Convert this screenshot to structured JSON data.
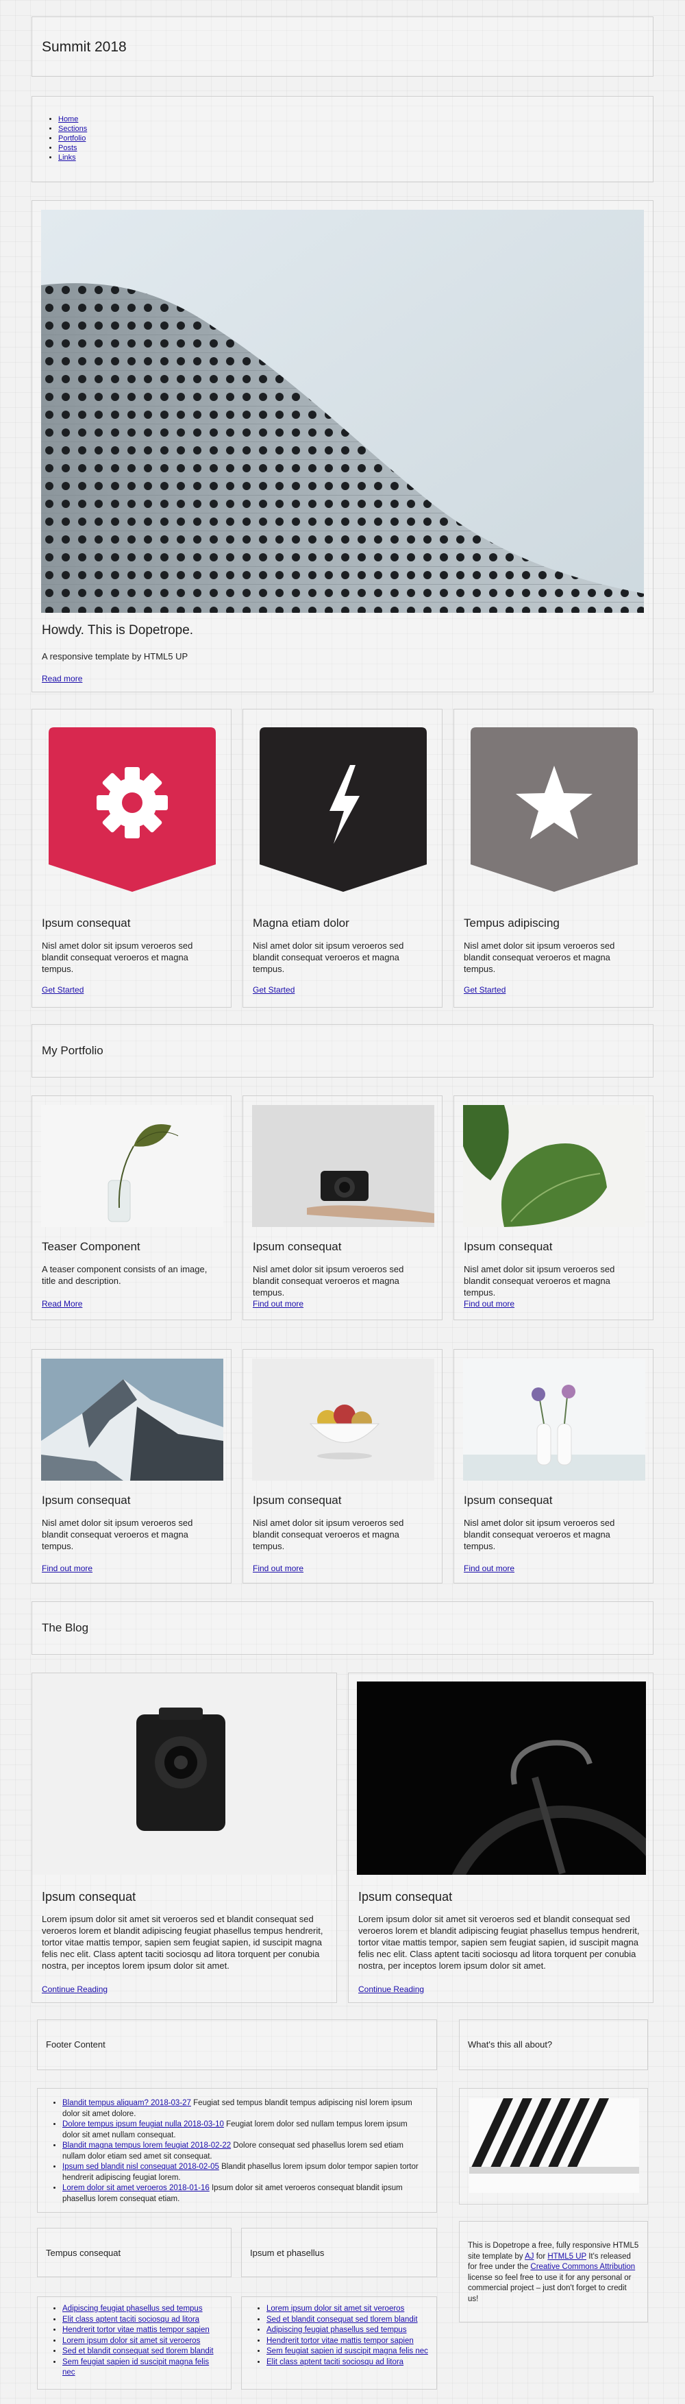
{
  "header": {
    "title": "Summit 2018"
  },
  "nav": {
    "items": [
      "Home",
      "Sections",
      "Portfolio",
      "Posts",
      "Links"
    ]
  },
  "hero": {
    "heading": "Howdy. This is Dopetrope.",
    "text": "A responsive template by HTML5 UP",
    "link": "Read more"
  },
  "features": [
    {
      "title": "Ipsum consequat",
      "text": "Nisl amet dolor sit ipsum veroeros sed blandit consequat veroeros et magna tempus.",
      "link": "Get Started",
      "color": "#d8284f",
      "icon": "gear-icon"
    },
    {
      "title": "Magna etiam dolor",
      "text": "Nisl amet dolor sit ipsum veroeros sed blandit consequat veroeros et magna tempus.",
      "link": "Get Started",
      "color": "#232021",
      "icon": "lightning-icon"
    },
    {
      "title": "Tempus adipiscing",
      "text": "Nisl amet dolor sit ipsum veroeros sed blandit consequat veroeros et magna tempus.",
      "link": "Get Started",
      "color": "#7d7777",
      "icon": "star-icon"
    }
  ],
  "portfolio": {
    "heading": "My Portfolio",
    "items": [
      {
        "title": "Teaser Component",
        "text": "A teaser component consists of an image, title and description.",
        "link": "Read More"
      },
      {
        "title": "Ipsum consequat",
        "text": "Nisl amet dolor sit ipsum veroeros sed blandit consequat veroeros et magna tempus.",
        "link": "Find out more"
      },
      {
        "title": "Ipsum consequat",
        "text": "Nisl amet dolor sit ipsum veroeros sed blandit consequat veroeros et magna tempus.",
        "link": "Find out more"
      },
      {
        "title": "Ipsum consequat",
        "text": "Nisl amet dolor sit ipsum veroeros sed blandit consequat veroeros et magna tempus.",
        "link": "Find out more"
      },
      {
        "title": "Ipsum consequat",
        "text": "Nisl amet dolor sit ipsum veroeros sed blandit consequat veroeros et magna tempus.",
        "link": "Find out more"
      },
      {
        "title": "Ipsum consequat",
        "text": "Nisl amet dolor sit ipsum veroeros sed blandit consequat veroeros et magna tempus.",
        "link": "Find out more"
      }
    ]
  },
  "blog": {
    "heading": "The Blog",
    "posts": [
      {
        "title": "Ipsum consequat",
        "text": "Lorem ipsum dolor sit amet sit veroeros sed et blandit consequat sed veroeros lorem et blandit adipiscing feugiat phasellus tempus hendrerit, tortor vitae mattis tempor, sapien sem feugiat sapien, id suscipit magna felis nec elit. Class aptent taciti sociosqu ad litora torquent per conubia nostra, per inceptos lorem ipsum dolor sit amet.",
        "link": "Continue Reading"
      },
      {
        "title": "Ipsum consequat",
        "text": "Lorem ipsum dolor sit amet sit veroeros sed et blandit consequat sed veroeros lorem et blandit adipiscing feugiat phasellus tempus hendrerit, tortor vitae mattis tempor, sapien sem feugiat sapien, id suscipit magna felis nec elit. Class aptent taciti sociosqu ad litora torquent per conubia nostra, per inceptos lorem ipsum dolor sit amet.",
        "link": "Continue Reading"
      }
    ]
  },
  "footer": {
    "content_heading": "Footer Content",
    "news": [
      {
        "link": "Blandit tempus aliquam? 2018-03-27",
        "text": " Feugiat sed tempus blandit tempus adipiscing nisl lorem ipsum dolor sit amet dolore."
      },
      {
        "link": "Dolore tempus ipsum feugiat nulla 2018-03-10",
        "text": " Feugiat lorem dolor sed nullam tempus lorem ipsum dolor sit amet nullam consequat."
      },
      {
        "link": "Blandit magna tempus lorem feugiat 2018-02-22",
        "text": " Dolore consequat sed phasellus lorem sed etiam nullam dolor etiam sed amet sit consequat."
      },
      {
        "link": "Ipsum sed blandit nisl consequat 2018-02-05",
        "text": " Blandit phasellus lorem ipsum dolor tempor sapien tortor hendrerit adipiscing feugiat lorem."
      },
      {
        "link": "Lorem dolor sit amet veroeros 2018-01-16",
        "text": " Ipsum dolor sit amet veroeros consequat blandit ipsum phasellus lorem consequat etiam."
      }
    ],
    "about_heading": "What's this all about?",
    "about": {
      "pre": "This is Dopetrope a free, fully responsive HTML5 site template by ",
      "link1": "AJ",
      "mid1": " for ",
      "link2": "HTML5 UP",
      "mid2": " It's released for free under the ",
      "link3": "Creative Commons Attribution",
      "post": " license so feel free to use it for any personal or commercial project – just don't forget to credit us!"
    },
    "col1_heading": "Tempus consequat",
    "col1_links": [
      "Adipiscing feugiat phasellus sed tempus",
      "Elit class aptent taciti sociosqu ad litora",
      "Hendrerit tortor vitae mattis tempor sapien",
      "Lorem ipsum dolor sit amet sit veroeros",
      "Sed et blandit consequat sed tlorem blandit",
      "Sem feugiat sapien id suscipit magna felis nec"
    ],
    "col2_heading": "Ipsum et phasellus",
    "col2_links": [
      "Lorem ipsum dolor sit amet sit veroeros",
      "Sed et blandit consequat sed tlorem blandit",
      "Adipiscing feugiat phasellus sed tempus",
      "Hendrerit tortor vitae mattis tempor sapien",
      "Sem feugiat sapien id suscipit magna felis nec",
      "Elit class aptent taciti sociosqu ad litora"
    ]
  }
}
